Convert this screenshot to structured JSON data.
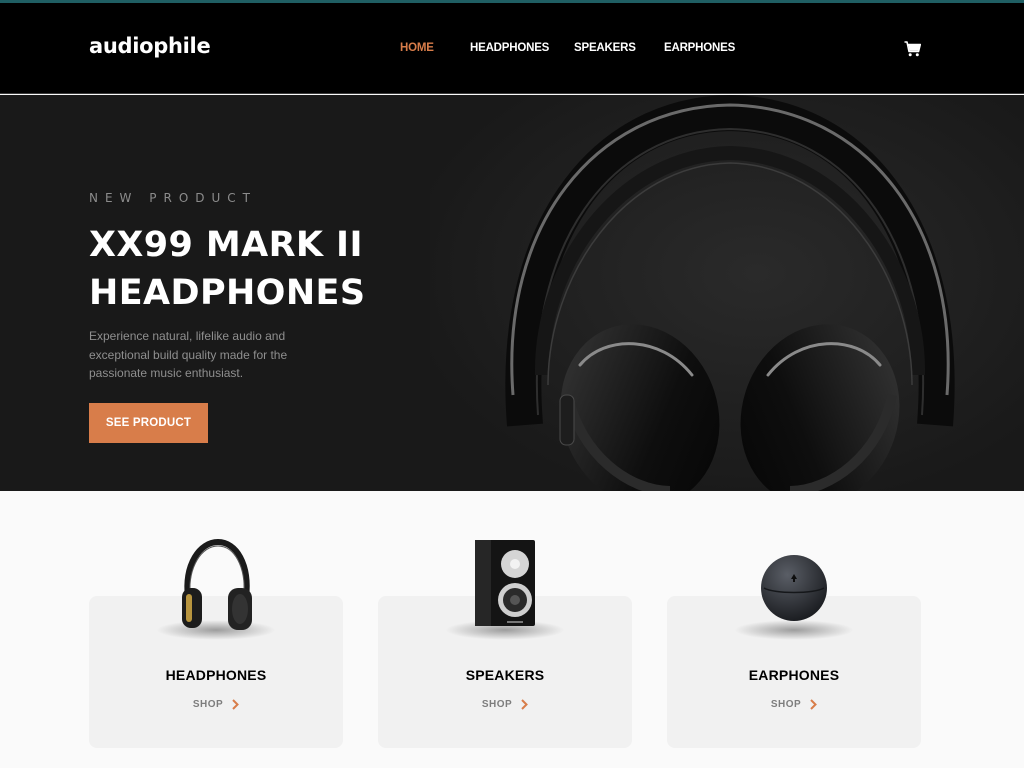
{
  "brand": {
    "logo": "audiophile",
    "accent_color": "#d87d4a"
  },
  "nav": {
    "items": [
      {
        "label": "HOME",
        "active": true
      },
      {
        "label": "HEADPHONES",
        "active": false
      },
      {
        "label": "SPEAKERS",
        "active": false
      },
      {
        "label": "EARPHONES",
        "active": false
      }
    ],
    "cart_icon": "cart-icon"
  },
  "hero": {
    "overline": "NEW PRODUCT",
    "title": "XX99 MARK II HEADPHONES",
    "description": "Experience natural, lifelike audio and exceptional build quality made for the passionate music enthusiast.",
    "cta": "SEE PRODUCT"
  },
  "categories": [
    {
      "title": "HEADPHONES",
      "shop_label": "SHOP",
      "icon": "headphones-image"
    },
    {
      "title": "SPEAKERS",
      "shop_label": "SHOP",
      "icon": "speaker-image"
    },
    {
      "title": "EARPHONES",
      "shop_label": "SHOP",
      "icon": "earphones-case-image"
    }
  ]
}
